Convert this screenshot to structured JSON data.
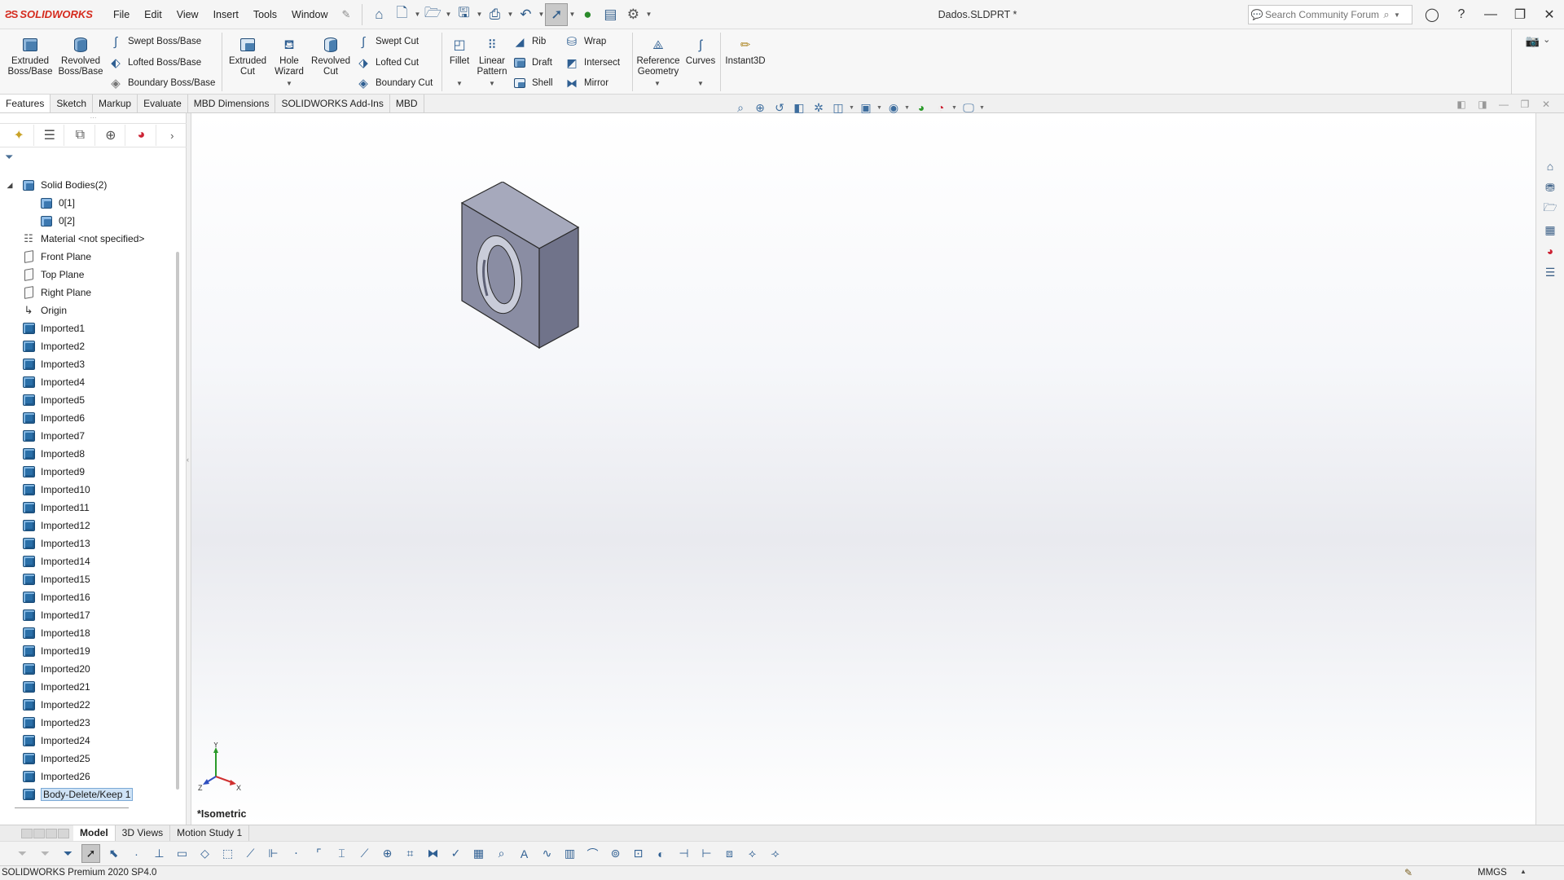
{
  "app": {
    "brand": "SOLIDWORKS",
    "document_title": "Dados.SLDPRT *",
    "menus": [
      "File",
      "Edit",
      "View",
      "Insert",
      "Tools",
      "Window"
    ],
    "search_placeholder": "Search Community Forum"
  },
  "ribbon": {
    "extruded_boss": "Extruded Boss/Base",
    "revolved_boss": "Revolved Boss/Base",
    "swept_boss": "Swept Boss/Base",
    "lofted_boss": "Lofted Boss/Base",
    "boundary_boss": "Boundary Boss/Base",
    "extruded_cut": "Extruded Cut",
    "hole_wizard": "Hole Wizard",
    "revolved_cut": "Revolved Cut",
    "swept_cut": "Swept Cut",
    "lofted_cut": "Lofted Cut",
    "boundary_cut": "Boundary Cut",
    "fillet": "Fillet",
    "linear_pattern": "Linear Pattern",
    "rib": "Rib",
    "draft": "Draft",
    "shell": "Shell",
    "wrap": "Wrap",
    "intersect": "Intersect",
    "mirror": "Mirror",
    "reference_geometry": "Reference Geometry",
    "curves": "Curves",
    "instant3d": "Instant3D"
  },
  "tabs": [
    "Features",
    "Sketch",
    "Markup",
    "Evaluate",
    "MBD Dimensions",
    "SOLIDWORKS Add-Ins",
    "MBD"
  ],
  "tree": {
    "solid_bodies": "Solid Bodies(2)",
    "bodies": [
      "0[1]",
      "0[2]"
    ],
    "material": "Material <not specified>",
    "front_plane": "Front Plane",
    "top_plane": "Top Plane",
    "right_plane": "Right Plane",
    "origin": "Origin",
    "imported": [
      "Imported1",
      "Imported2",
      "Imported3",
      "Imported4",
      "Imported5",
      "Imported6",
      "Imported7",
      "Imported8",
      "Imported9",
      "Imported10",
      "Imported11",
      "Imported12",
      "Imported13",
      "Imported14",
      "Imported15",
      "Imported16",
      "Imported17",
      "Imported18",
      "Imported19",
      "Imported20",
      "Imported21",
      "Imported22",
      "Imported23",
      "Imported24",
      "Imported25",
      "Imported26"
    ],
    "last_feature": "Body-Delete/Keep 1"
  },
  "viewport": {
    "view_label": "*Isometric",
    "triad": {
      "y": "Y",
      "x": "X",
      "z": "Z"
    }
  },
  "bottom_tabs": [
    "Model",
    "3D Views",
    "Motion Study 1"
  ],
  "status": {
    "version": "SOLIDWORKS Premium 2020 SP4.0",
    "units": "MMGS"
  },
  "colors": {
    "brand_red": "#d52b1e",
    "icon_blue": "#2f5f92",
    "selection": "#cfe3f6",
    "part_front": "#8a8da3",
    "part_side": "#70738a",
    "part_top": "#a6a9bc"
  }
}
